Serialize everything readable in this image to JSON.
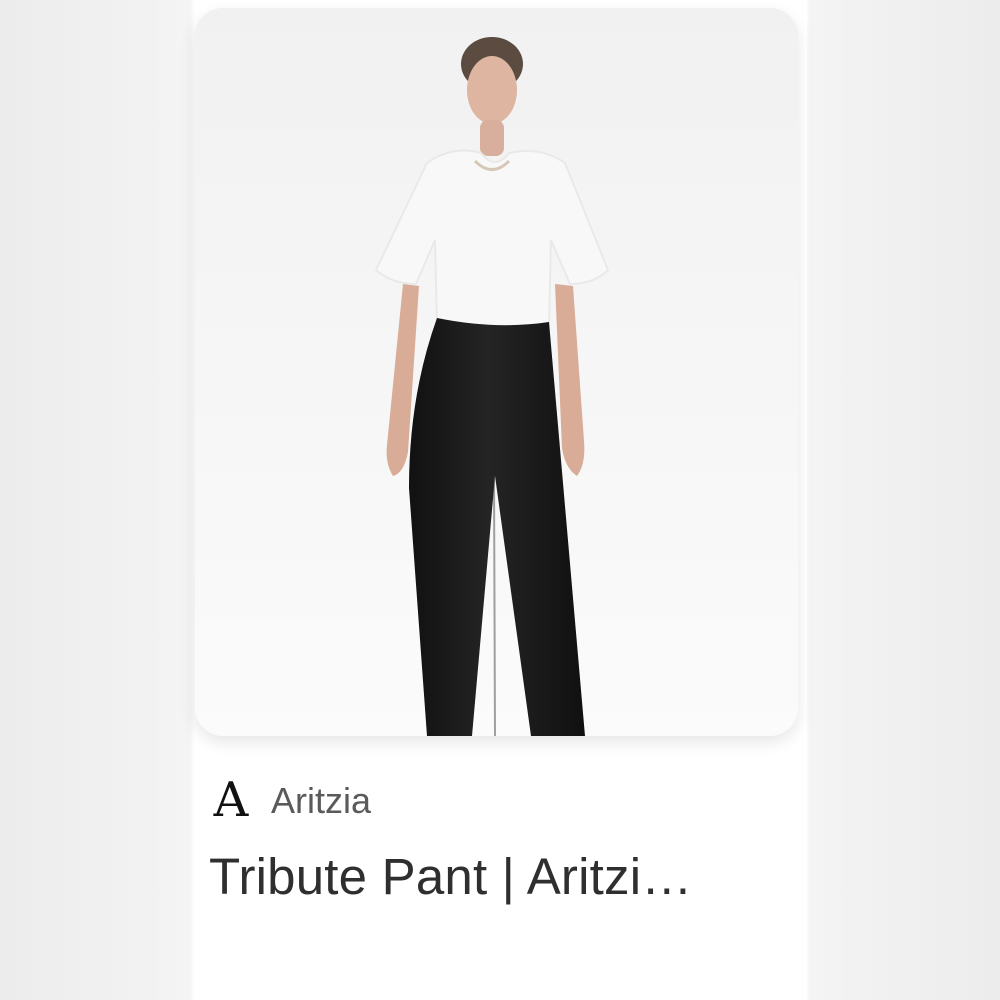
{
  "result": {
    "source_logo": "A",
    "source_name": "Aritzia",
    "title": "Tribute Pant | Aritzi…"
  },
  "image": {
    "description_icon": "product-photo"
  },
  "colors": {
    "card_background": "#ffffff",
    "page_background": "#f2f2f2",
    "title_text": "#2f2f2f",
    "source_text": "#5a5a5a",
    "pants": "#151515",
    "shirt": "#f8f8f8"
  }
}
